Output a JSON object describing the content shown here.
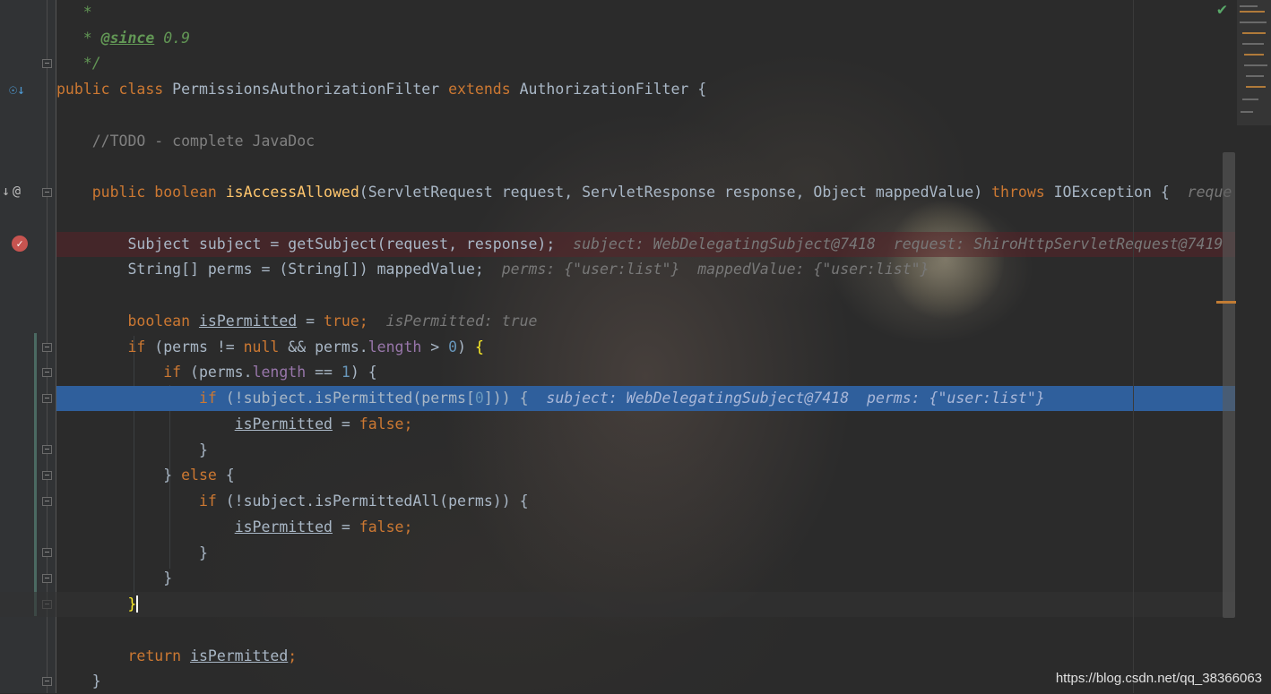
{
  "editor": {
    "lines": {
      "l1": "   *",
      "l2_prefix": "   * ",
      "l2_tag": "@since",
      "l2_val": " 0.9",
      "l3": "   */",
      "l4_kw1": "public class ",
      "l4_name": "PermissionsAuthorizationFilter ",
      "l4_kw2": "extends ",
      "l4_rest": "AuthorizationFilter {",
      "l6": "    //TODO - complete JavaDoc",
      "l8_kw": "    public boolean ",
      "l8_fn": "isAccessAllowed",
      "l8_params": "(ServletRequest request, ServletResponse response, Object mappedValue) ",
      "l8_throws": "throws ",
      "l8_exc": "IOException {  ",
      "l8_hint": "reque",
      "l10_code": "        Subject subject = getSubject(request, response);  ",
      "l10_hint": "subject: WebDelegatingSubject@7418  request: ShiroHttpServletRequest@7419",
      "l11_code": "        String[] perms = (String[]) mappedValue;  ",
      "l11_hint": "perms: {\"user:list\"}  mappedValue: {\"user:list\"}",
      "l13_kw": "        boolean ",
      "l13_var": "isPermitted",
      "l13_eq": " = ",
      "l13_val": "true",
      "l13_semi": ";  ",
      "l13_hint": "isPermitted: true",
      "l14_if": "        if ",
      "l14_a": "(perms != ",
      "l14_null": "null",
      "l14_b": " && perms.",
      "l14_len": "length",
      "l14_c": " > ",
      "l14_zero": "0",
      "l14_d": ") ",
      "l14_brace": "{",
      "l15_if": "            if ",
      "l15_a": "(perms.",
      "l15_len": "length",
      "l15_b": " == ",
      "l15_one": "1",
      "l15_c": ") {",
      "l16_if": "                if ",
      "l16_a": "(!subject.isPermitted(perms[",
      "l16_zero": "0",
      "l16_b": "])) {  ",
      "l16_hint": "subject: WebDelegatingSubject@7418  perms: {\"user:list\"}",
      "l17_indent": "                    ",
      "l17_var": "isPermitted",
      "l17_eq": " = ",
      "l17_val": "false",
      "l17_semi": ";",
      "l18": "                }",
      "l19_a": "            } ",
      "l19_else": "else",
      "l19_b": " {",
      "l20_if": "                if ",
      "l20_a": "(!subject.isPermittedAll(perms)) {",
      "l21_indent": "                    ",
      "l21_var": "isPermitted",
      "l21_eq": " = ",
      "l21_val": "false",
      "l21_semi": ";",
      "l22": "                }",
      "l23": "            }",
      "l24_indent": "        ",
      "l24_brace": "}",
      "l26_kw": "        return ",
      "l26_var": "isPermitted",
      "l26_semi": ";",
      "l27": "    }"
    }
  },
  "gutter": {
    "override_icon": "override-icon",
    "breakpoint_icon": "breakpoint-icon"
  },
  "watermark": "https://blog.csdn.net/qq_38366063",
  "colors": {
    "background": "#2b2b2b",
    "keyword": "#cc7832",
    "method": "#ffc66d",
    "number": "#6897bb",
    "field": "#9876aa",
    "current_line": "#2f5f9c",
    "breakpoint_line": "#5a2328"
  }
}
